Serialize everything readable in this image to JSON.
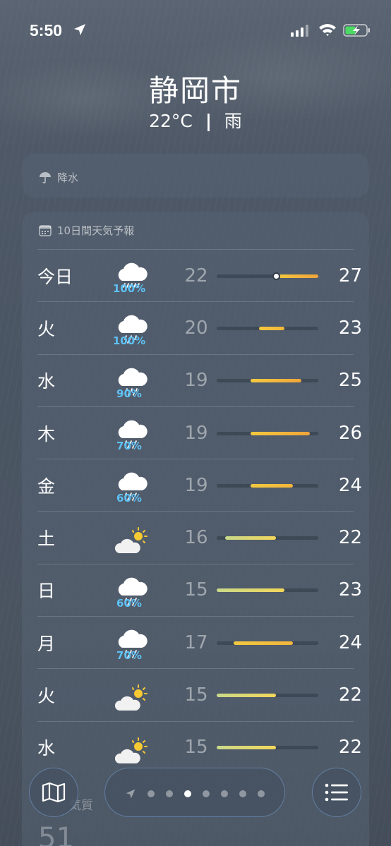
{
  "status_bar": {
    "time": "5:50",
    "location_icon": "location-arrow-icon",
    "signal_icon": "signal-icon",
    "wifi_icon": "wifi-icon",
    "battery_icon": "battery-charging-icon"
  },
  "location": {
    "city": "静岡市",
    "temperature": "22°C",
    "separator": "|",
    "condition": "雨"
  },
  "precipitation": {
    "icon": "umbrella-icon",
    "title": "降水"
  },
  "forecast": {
    "icon": "calendar-icon",
    "title": "10日間天気予報",
    "range_min": 15,
    "range_max": 27,
    "days": [
      {
        "day": "今日",
        "icon": "cloud-heavy-rain-icon",
        "pop": "100%",
        "low": "22",
        "high": "27",
        "current": 22
      },
      {
        "day": "火",
        "icon": "cloud-rain-icon",
        "pop": "100%",
        "low": "20",
        "high": "23"
      },
      {
        "day": "水",
        "icon": "cloud-drizzle-icon",
        "pop": "90%",
        "low": "19",
        "high": "25"
      },
      {
        "day": "木",
        "icon": "cloud-rain-icon",
        "pop": "70%",
        "low": "19",
        "high": "26"
      },
      {
        "day": "金",
        "icon": "cloud-rain-icon",
        "pop": "60%",
        "low": "19",
        "high": "24"
      },
      {
        "day": "土",
        "icon": "partly-sunny-icon",
        "pop": "",
        "low": "16",
        "high": "22"
      },
      {
        "day": "日",
        "icon": "cloud-rain-icon",
        "pop": "60%",
        "low": "15",
        "high": "23"
      },
      {
        "day": "月",
        "icon": "cloud-rain-icon",
        "pop": "70%",
        "low": "17",
        "high": "24"
      },
      {
        "day": "火",
        "icon": "partly-sunny-icon",
        "pop": "",
        "low": "15",
        "high": "22"
      },
      {
        "day": "水",
        "icon": "partly-sunny-icon",
        "pop": "",
        "low": "15",
        "high": "22"
      }
    ]
  },
  "air_quality": {
    "label_partial": "気質",
    "value_partial": "51"
  },
  "toolbar": {
    "map_icon": "map-icon",
    "nav_icon": "location-arrow-icon",
    "page_count": 7,
    "active_page": 2,
    "list_icon": "list-icon"
  },
  "colors": {
    "pop_blue": "#5ec1f5",
    "bar_orange": "#f0a43a",
    "bar_yellow": "#f3c93f",
    "bar_green": "#c9d98a"
  }
}
